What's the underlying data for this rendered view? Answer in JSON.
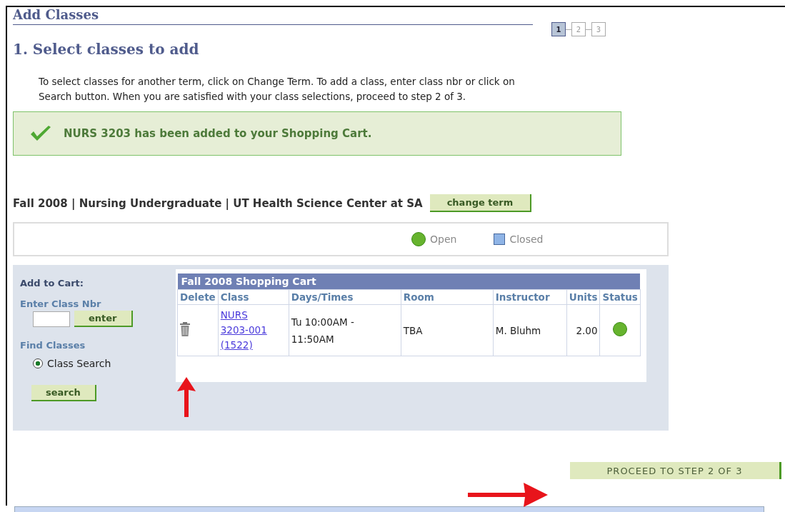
{
  "page_title": "Add Classes",
  "steps": [
    {
      "label": "1",
      "selected": true
    },
    {
      "label": "2",
      "selected": false
    },
    {
      "label": "3",
      "selected": false
    }
  ],
  "heading": "1.  Select classes to add",
  "instructions": "To select classes for another term,  click on Change Term.  To add a class, enter class nbr or click on Search button.  When you are satisfied with your class selections, proceed to step 2 of 3.",
  "message": "NURS 3203 has been added to your Shopping Cart.",
  "term_line": "Fall 2008 | Nursing Undergraduate | UT Health Science Center at SA",
  "change_term_button": "change term",
  "legend": [
    {
      "kind": "circle",
      "label": "Open",
      "color": "#66b32e"
    },
    {
      "kind": "square",
      "label": "Closed",
      "color": "#8fb4e6"
    }
  ],
  "add_to_cart": {
    "title": "Add to Cart:",
    "enter_label": "Enter Class Nbr",
    "enter_button": "enter",
    "find_label": "Find Classes",
    "options": [
      {
        "label": "Class Search",
        "selected": true
      }
    ],
    "search_button": "search"
  },
  "cart": {
    "title": "Fall 2008 Shopping Cart",
    "columns": [
      "Delete",
      "Class",
      "Days/Times",
      "Room",
      "Instructor",
      "Units",
      "Status"
    ],
    "rows": [
      {
        "class_lines": [
          "NURS",
          "3203-001",
          "(1522)"
        ],
        "days_times": "Tu 10:00AM - 11:50AM",
        "room": "TBA",
        "instructor": "M. Bluhm",
        "units": "2.00",
        "color": "#66b32e"
      }
    ]
  },
  "proceed_button": "PROCEED TO STEP 2 OF 3"
}
